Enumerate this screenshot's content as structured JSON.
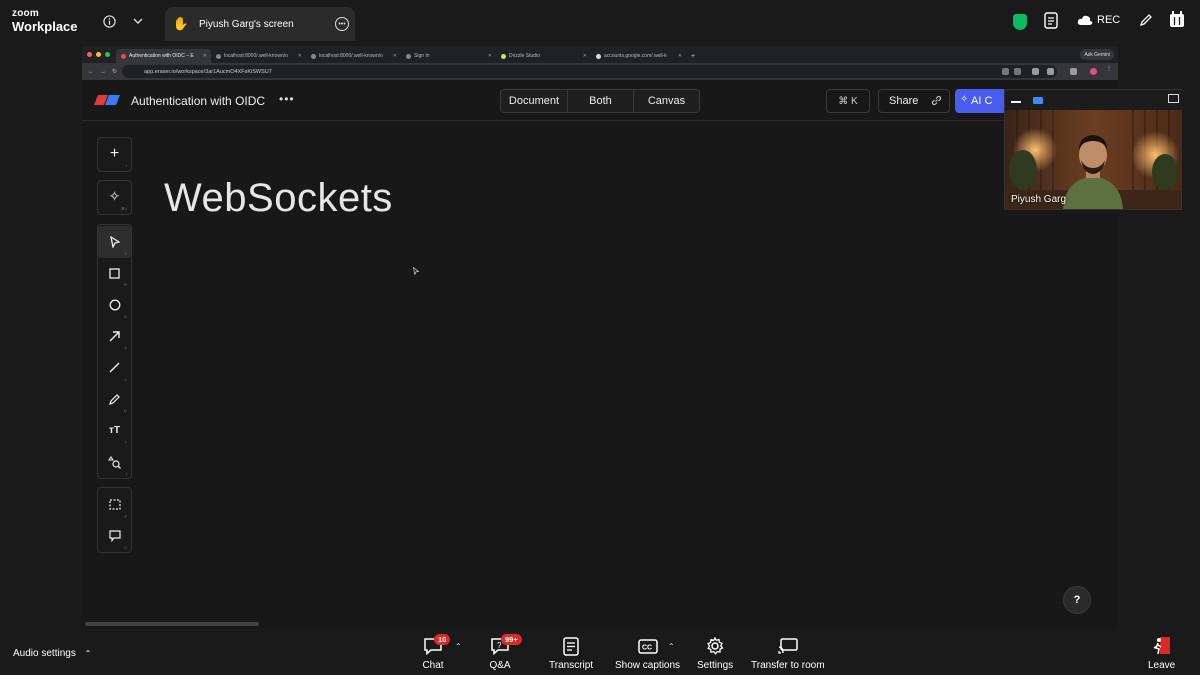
{
  "zoom": {
    "logo_line1": "zoom",
    "logo_line2": "Workplace",
    "screen_tab_label": "Piyush Garg's screen",
    "rec_label": "REC",
    "brand_color": "#0b5cff"
  },
  "browser": {
    "tabs": [
      {
        "label": "Authentication with OIDC – E"
      },
      {
        "label": "localhost:8000/.well-known/o"
      },
      {
        "label": "localhost:8000/.well-known/o"
      },
      {
        "label": "Sign In"
      },
      {
        "label": "Drizzle Studio"
      },
      {
        "label": "accounts.google.com/.well-k"
      }
    ],
    "ask_gemini": "Ask Gemini",
    "url": "app.eraser.io/workspace/3ar1AucmO4XFsKiSWSU7"
  },
  "eraser": {
    "doc_title": "Authentication with OIDC",
    "more_label": "•••",
    "view_modes": [
      "Document",
      "Both",
      "Canvas"
    ],
    "shortcut_label": "⌘ K",
    "share_label": "Share",
    "ai_label": "AI C",
    "canvas_heading": "WebSockets",
    "help_label": "?",
    "accent": "#4a5cf0"
  },
  "toolbar": {
    "top": [
      {
        "name": "add-icon",
        "glyph": "+",
        "key": "/"
      },
      {
        "name": "ai-diagram-icon",
        "glyph": "✧",
        "key": "⌘J"
      }
    ],
    "tools": [
      {
        "name": "select-icon",
        "glyph": "➤",
        "key": "V"
      },
      {
        "name": "rectangle-icon",
        "glyph": "□",
        "key": "R"
      },
      {
        "name": "ellipse-icon",
        "glyph": "○",
        "key": "O"
      },
      {
        "name": "arrow-icon",
        "glyph": "↗",
        "key": "A"
      },
      {
        "name": "line-icon",
        "glyph": "╱",
        "key": "L"
      },
      {
        "name": "pencil-icon",
        "glyph": "✎",
        "key": "D"
      },
      {
        "name": "text-icon",
        "glyph": "ᴛT",
        "key": "T"
      },
      {
        "name": "shapes-search-icon",
        "glyph": "⌕",
        "key": "I"
      }
    ],
    "bottom": [
      {
        "name": "frame-icon",
        "glyph": "⬚",
        "key": "F"
      },
      {
        "name": "comment-icon",
        "glyph": "▭",
        "key": "C"
      }
    ]
  },
  "video": {
    "participant_name": "Piyush Garg"
  },
  "bottom_bar": {
    "audio_settings": "Audio settings",
    "chat_label": "Chat",
    "chat_badge": "10",
    "qa_label": "Q&A",
    "qa_badge": "99+",
    "transcript_label": "Transcript",
    "captions_label": "Show captions",
    "settings_label": "Settings",
    "transfer_label": "Transfer to room",
    "leave_label": "Leave",
    "leave_color": "#e02828"
  }
}
